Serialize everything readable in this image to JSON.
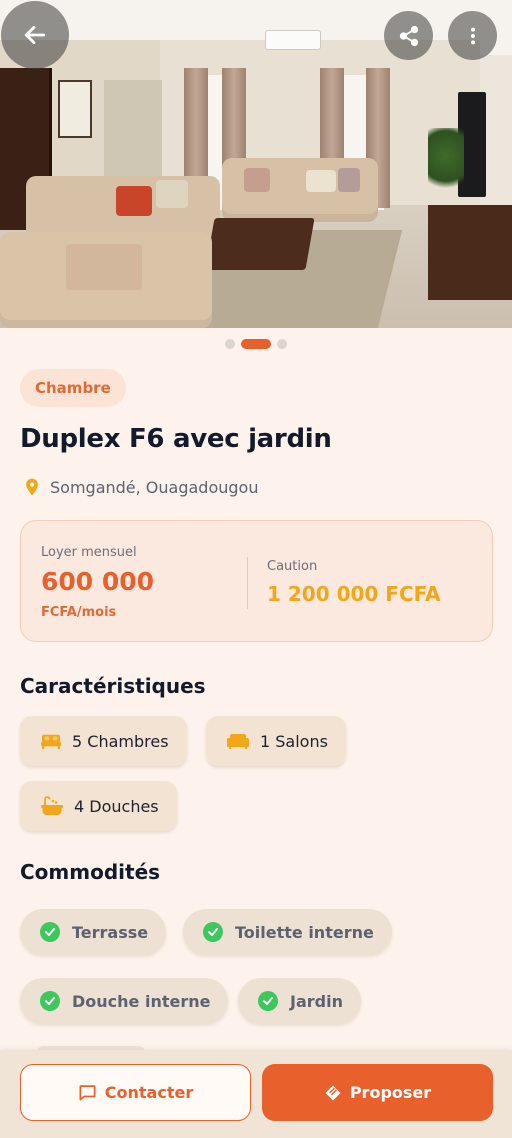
{
  "listing": {
    "category": "Chambre",
    "title": "Duplex F6 avec jardin",
    "location": "Somgandé, Ouagadougou"
  },
  "carousel": {
    "total": 3,
    "active_index": 1
  },
  "pricing": {
    "rent_label": "Loyer mensuel",
    "rent_value": "600 000",
    "rent_unit": "FCFA/mois",
    "deposit_label": "Caution",
    "deposit_value": "1 200 000 FCFA"
  },
  "features": {
    "title": "Caractéristiques",
    "items": [
      {
        "label": "5 Chambres",
        "icon": "bed-icon"
      },
      {
        "label": "1 Salons",
        "icon": "sofa-icon"
      },
      {
        "label": "4 Douches",
        "icon": "bathtub-icon"
      }
    ]
  },
  "amenities": {
    "title": "Commodités",
    "items": [
      "Terrasse",
      "Toilette interne",
      "Douche interne",
      "Jardin"
    ]
  },
  "actions": {
    "contact_label": "Contacter",
    "propose_label": "Proposer"
  },
  "colors": {
    "accent": "#e8602b",
    "deposit": "#f2a71b",
    "check": "#3ec65f",
    "background": "#fdf3ec"
  },
  "icons": {
    "back": "arrow-left-icon",
    "share": "share-icon",
    "more": "more-vertical-icon",
    "location": "map-pin-icon",
    "amenity": "check-circle-icon",
    "contact": "message-icon",
    "propose": "offer-tag-icon"
  }
}
